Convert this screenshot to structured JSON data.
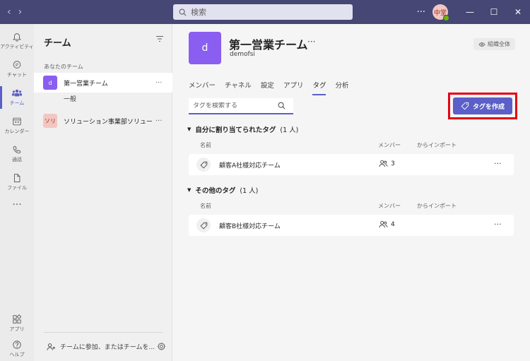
{
  "titlebar": {
    "back_icon": "chevron-left-icon",
    "forward_icon": "chevron-right-icon",
    "search_placeholder": "検索",
    "more": "···",
    "avatar_initials": "中堂",
    "minimize": "—",
    "maximize": "☐",
    "close": "✕"
  },
  "rail": {
    "items": [
      {
        "label": "アクティビティ",
        "icon": "bell-icon"
      },
      {
        "label": "チャット",
        "icon": "chat-icon"
      },
      {
        "label": "チーム",
        "icon": "teams-icon"
      },
      {
        "label": "カレンダー",
        "icon": "calendar-icon"
      },
      {
        "label": "通話",
        "icon": "phone-icon"
      },
      {
        "label": "ファイル",
        "icon": "file-icon"
      }
    ],
    "more": "···",
    "apps_label": "アプリ",
    "help_label": "ヘルプ"
  },
  "panel": {
    "title": "チーム",
    "section_label": "あなたのチーム",
    "teams": [
      {
        "avatar": "d",
        "name": "第一営業チーム",
        "more": "···",
        "color": "#8a5ef0"
      },
      {
        "avatar": "ソリ",
        "name": "ソリューション事業部ソリュー...",
        "more": "···",
        "color": "#f3c7c1"
      }
    ],
    "channel": "一般",
    "join_label": "チームに参加、またはチームを..."
  },
  "main": {
    "avatar": "d",
    "title": "第一営業チーム",
    "title_more": "···",
    "subtitle": "demofsi",
    "org_badge": "組織全体",
    "tabs": [
      "メンバー",
      "チャネル",
      "設定",
      "アプリ",
      "タグ",
      "分析"
    ],
    "active_tab": "タグ",
    "tag_search_placeholder": "タグを検索する",
    "create_button": "タグを作成",
    "groups": [
      {
        "title": "自分に割り当てられたタグ",
        "count": "(1 人)",
        "columns": {
          "name": "名前",
          "members": "メンバー",
          "import": "からインポート"
        },
        "tags": [
          {
            "name": "顧客A社様対応チーム",
            "members": "3",
            "more": "···"
          }
        ]
      },
      {
        "title": "その他のタグ",
        "count": "(1 人)",
        "columns": {
          "name": "名前",
          "members": "メンバー",
          "import": "からインポート"
        },
        "tags": [
          {
            "name": "顧客B社様対応チーム",
            "members": "4",
            "more": "···"
          }
        ]
      }
    ]
  },
  "colors": {
    "titlebar": "#464775",
    "accent": "#5b5fc7",
    "highlight_frame": "#e60012",
    "team_avatar": "#8a5ef0"
  }
}
